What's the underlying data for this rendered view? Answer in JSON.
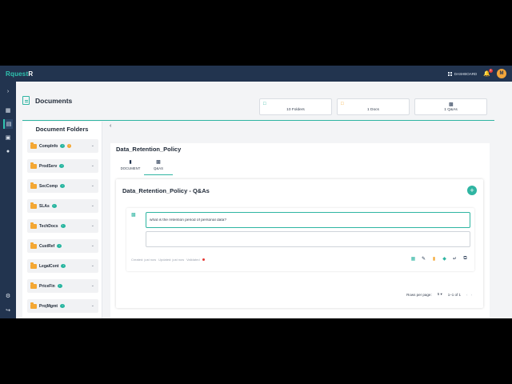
{
  "app": {
    "logo_main": "Rquest",
    "logo_accent": "R"
  },
  "topbar": {
    "dashboard_label": "DASHBOARD",
    "notification_count": "1",
    "avatar_initial": "M"
  },
  "rail": {
    "icons": [
      "chevron-right-icon",
      "grid-icon",
      "document-icon",
      "inbox-icon",
      "users-icon",
      "settings-icon",
      "logout-icon"
    ]
  },
  "page": {
    "title": "Documents"
  },
  "stats": [
    {
      "label": "10 Folders",
      "icon": "folder-icon"
    },
    {
      "label": "1 Docs",
      "icon": "file-icon"
    },
    {
      "label": "1 Q&As",
      "icon": "chat-icon"
    }
  ],
  "folders": {
    "heading": "Document Folders",
    "items": [
      {
        "name": "CompInfo",
        "warning": true
      },
      {
        "name": "ProdServ",
        "warning": false
      },
      {
        "name": "SecComp",
        "warning": false
      },
      {
        "name": "SLAs",
        "warning": false
      },
      {
        "name": "TechDocs",
        "warning": false
      },
      {
        "name": "CustRef",
        "warning": false
      },
      {
        "name": "LegalCont",
        "warning": false
      },
      {
        "name": "PriceFin",
        "warning": false
      },
      {
        "name": "ProjMgmt",
        "warning": false
      }
    ]
  },
  "detail": {
    "doc_title": "Data_Retention_Policy",
    "tabs": [
      {
        "label": "DOCUMENT"
      },
      {
        "label": "Q&AS"
      }
    ],
    "active_tab": "Q&AS",
    "qa_title": "Data_Retention_Policy - Q&As",
    "question_value": "what is the retention period of personal data?",
    "answer_value": "",
    "meta": {
      "created": "Created: just now",
      "updated": "Updated: just now",
      "validated": "Validated"
    },
    "pager": {
      "rows_label": "Rows per page:",
      "rows_value": "5",
      "range": "1–1 of 1"
    }
  },
  "colors": {
    "accent": "#2fb5a2",
    "nav_bg": "#22344f",
    "folder": "#f4a733",
    "validated_dot": "#e53935"
  }
}
